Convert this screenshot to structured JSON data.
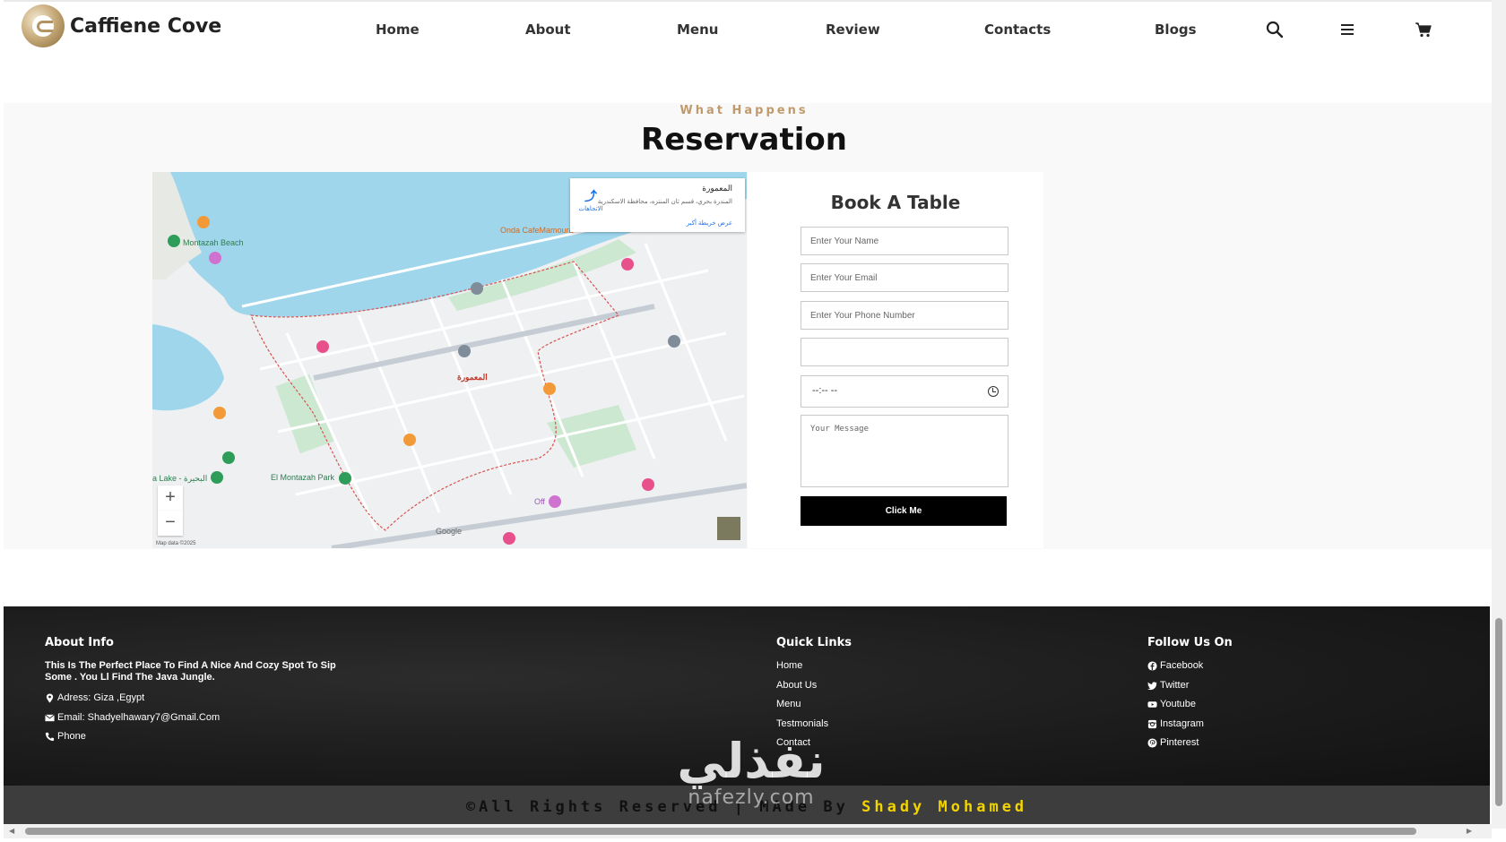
{
  "header": {
    "brand": "Caffiene Cove",
    "nav": [
      {
        "label": "Home"
      },
      {
        "label": "About"
      },
      {
        "label": "Menu"
      },
      {
        "label": "Review"
      },
      {
        "label": "Contacts"
      },
      {
        "label": "Blogs"
      }
    ],
    "icons": [
      "search-icon",
      "menu-bars-icon",
      "cart-icon"
    ]
  },
  "reservation": {
    "eyebrow": "What Happens",
    "title": "Reservation",
    "map": {
      "card_title": "المعمورة",
      "card_subtitle": "المندرة بحري، قسم ثان المنتزه، محافظة الاسكندرية",
      "card_link": "عرض خريطة أكبر",
      "directions_label": "الاتجاهات",
      "labels": {
        "beach": "Montazah Beach",
        "cafe": "Onda CafeMamoura",
        "park": "El Montazah Park",
        "mamoura": "المعمورة",
        "lake": "a Lake - البحيرة",
        "off": "Off"
      },
      "footer": "Map data ©2025",
      "zoom_in": "+",
      "zoom_out": "−",
      "google": "Google"
    },
    "form": {
      "title": "Book A Table",
      "name_placeholder": "Enter Your Name",
      "email_placeholder": "Enter Your Email",
      "phone_placeholder": "Enter Your Phone Number",
      "date_value": "",
      "time_value": "--:-- --",
      "message_placeholder": "Your Message",
      "submit_label": "Click Me"
    }
  },
  "footer": {
    "about": {
      "heading": "About Info",
      "text": "This Is The Perfect Place To Find A Nice And Cozy Spot To Sip Some . You Ll Find The Java Jungle.",
      "address": "Adress: Giza ,Egypt",
      "email": "Email: Shadyelhawary7@Gmail.Com",
      "phone": "Phone"
    },
    "quick_links": {
      "heading": "Quick Links",
      "items": [
        "Home",
        "About Us",
        "Menu",
        "Testmonials",
        "Contact"
      ]
    },
    "follow": {
      "heading": "Follow Us On",
      "items": [
        "Facebook",
        "Twitter",
        "Youtube",
        "Instagram",
        "Pinterest"
      ]
    },
    "copyright_prefix": "©All Rights Reserved | MAde By",
    "copyright_name": "Shady Mohamed"
  },
  "watermark": {
    "arabic": "نفذلي",
    "latin": "nafezly.com"
  }
}
